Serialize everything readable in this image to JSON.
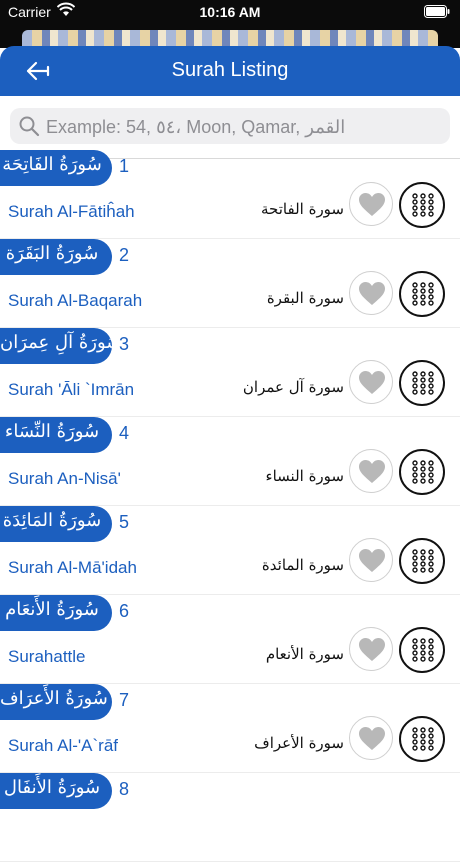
{
  "status": {
    "carrier": "Carrier",
    "time": "10:16 AM"
  },
  "nav": {
    "title": "Surah Listing"
  },
  "search": {
    "placeholder": "Example: 54, ٥٤، Moon, Qamar, القمر"
  },
  "surahs": [
    {
      "number": "1",
      "banner": "سُورَةُ الفَاتِحَة",
      "english": "Surah Al-Fātiĥah",
      "arabic": "سورة الفاتحة"
    },
    {
      "number": "2",
      "banner": "سُورَةُ البَقَرَة",
      "english": "Surah Al-Baqarah",
      "arabic": "سورة البقرة"
    },
    {
      "number": "3",
      "banner": "سُورَةُ آلِ عِمرَان",
      "english": "Surah 'Āli `Imrān",
      "arabic": "سورة آل عمران"
    },
    {
      "number": "4",
      "banner": "سُورَةُ النِّسَاء",
      "english": "Surah An-Nisā'",
      "arabic": "سورة النساء"
    },
    {
      "number": "5",
      "banner": "سُورَةُ المَائِدَة",
      "english": "Surah Al-Mā'idah",
      "arabic": "سورة المائدة"
    },
    {
      "number": "6",
      "banner": "سُورَةُ الأَنعَام",
      "english": "Surahattle",
      "arabic": "سورة الأنعام"
    },
    {
      "number": "7",
      "banner": "سُورَةُ الأَعرَاف",
      "english": "Surah Al-'A`rāf",
      "arabic": "سورة الأعراف"
    },
    {
      "number": "8",
      "banner": "سُورَةُ الأَنفَال",
      "english": "",
      "arabic": ""
    }
  ],
  "icons": {
    "back": "back-arrow-icon",
    "search": "search-icon",
    "favorite": "heart-icon",
    "menu": "grid-dots-icon"
  },
  "colors": {
    "accent": "#1c5fbf",
    "heart": "#b8b8b8"
  }
}
